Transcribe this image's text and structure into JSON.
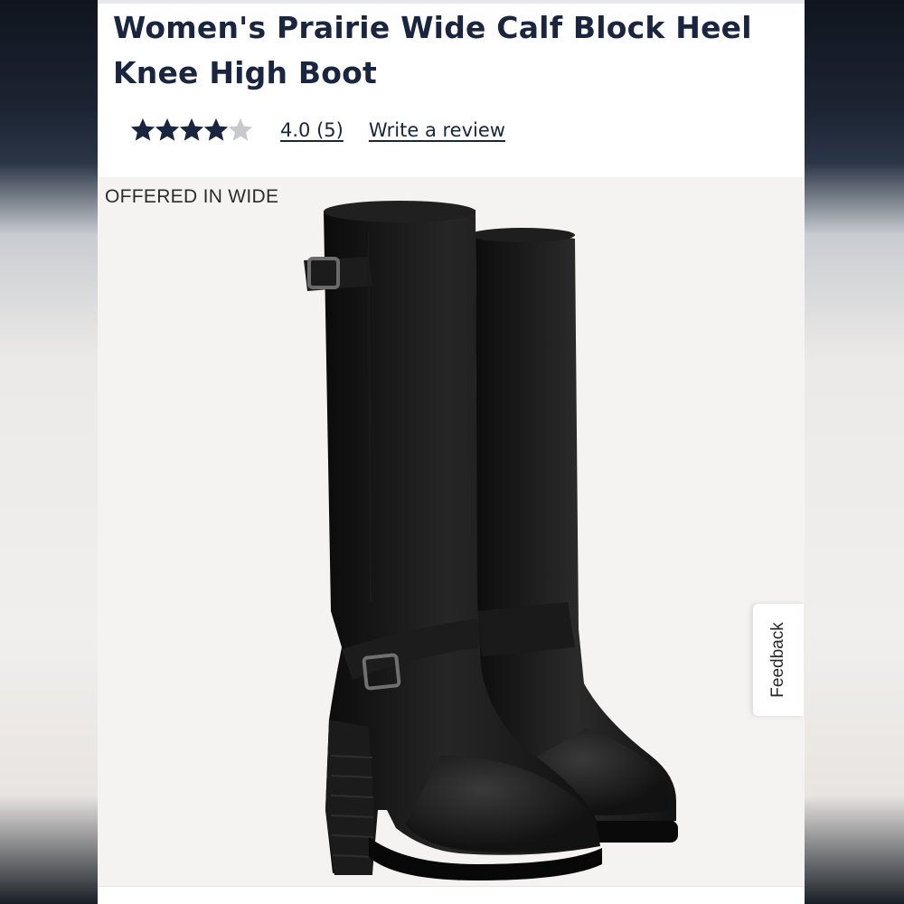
{
  "product": {
    "title": "Women's Prairie Wide Calf Block Heel Knee High Boot",
    "rating": {
      "value": 4.0,
      "max": 5,
      "link_text": "4.0 (5)",
      "write_review_label": "Write a review"
    },
    "image": {
      "badge": "OFFERED IN WIDE",
      "alt_subject": "black-knee-high-boots-icon"
    }
  },
  "feedback_tab": {
    "label": "Feedback"
  },
  "colors": {
    "title_text": "#1a2540",
    "star_filled": "#1a2540",
    "star_empty": "#c7c9cd",
    "image_bg": "#f4f3f1",
    "boot_leather": "#141414"
  }
}
